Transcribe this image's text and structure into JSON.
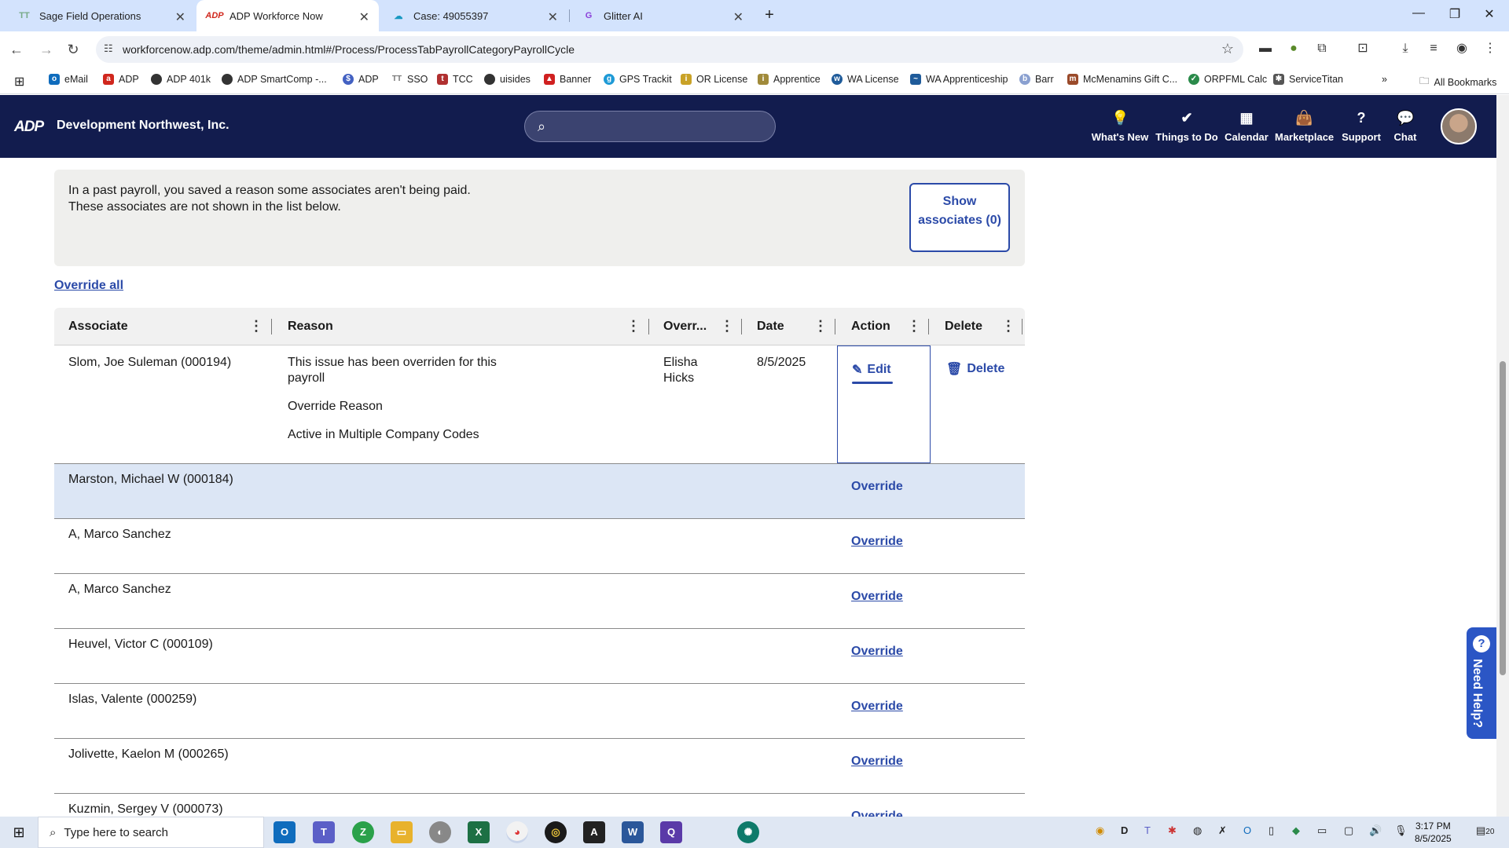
{
  "browser": {
    "tabs": [
      {
        "title": "Sage Field Operations",
        "icon": "TT"
      },
      {
        "title": "ADP Workforce Now",
        "icon": "ADP"
      },
      {
        "title": "Case: 49055397",
        "icon": "cloud"
      },
      {
        "title": "Glitter AI",
        "icon": "G"
      }
    ],
    "url": "workforcenow.adp.com/theme/admin.html#/Process/ProcessTabPayrollCategoryPayrollCycle",
    "bookmarks": [
      "eMail",
      "ADP",
      "ADP 401k",
      "ADP SmartComp -...",
      "ADP",
      "SSO",
      "TCC",
      "uisides",
      "Banner",
      "GPS Trackit",
      "OR License",
      "Apprentice",
      "WA License",
      "WA Apprenticeship",
      "Barr",
      "McMenamins Gift C...",
      "ORPFML Calc",
      "ServiceTitan"
    ],
    "all_bookmarks": "All Bookmarks"
  },
  "header": {
    "logo": "ADP",
    "company": "Development Northwest, Inc.",
    "nav": [
      {
        "label": "What's New",
        "icon": "lightbulb-icon"
      },
      {
        "label": "Things to Do",
        "icon": "checkmark-icon"
      },
      {
        "label": "Calendar",
        "icon": "calendar-icon"
      },
      {
        "label": "Marketplace",
        "icon": "bag-icon"
      },
      {
        "label": "Support",
        "icon": "question-icon"
      },
      {
        "label": "Chat",
        "icon": "chat-icon"
      }
    ]
  },
  "banner": {
    "text": "In a past payroll, you saved a reason some associates aren't being paid. These associates are not shown in the list below.",
    "button": "Show associates (0)"
  },
  "override_all": "Override all",
  "table": {
    "headers": [
      "Associate",
      "Reason",
      "Overr...",
      "Date",
      "Action",
      "Delete"
    ],
    "first_row": {
      "associate": "Slom, Joe Suleman (000194)",
      "reasons": [
        "This issue has been overriden for this payroll",
        "Override Reason",
        "Active in Multiple Company Codes"
      ],
      "overridden_by": "Elisha Hicks",
      "date": "8/5/2025",
      "edit": "Edit",
      "delete": "Delete"
    },
    "rows": [
      {
        "associate": "Marston, Michael W (000184)",
        "action": "Override"
      },
      {
        "associate": "A, Marco Sanchez",
        "action": "Override"
      },
      {
        "associate": "A, Marco Sanchez",
        "action": "Override"
      },
      {
        "associate": "Heuvel, Victor C (000109)",
        "action": "Override"
      },
      {
        "associate": "Islas, Valente (000259)",
        "action": "Override"
      },
      {
        "associate": "Jolivette, Kaelon M (000265)",
        "action": "Override"
      },
      {
        "associate": "Kuzmin, Sergey V (000073)",
        "action": "Override"
      }
    ]
  },
  "need_help": "Need Help?",
  "taskbar": {
    "search_placeholder": "Type here to search",
    "time": "3:17 PM",
    "date": "8/5/2025",
    "notification_count": "20"
  },
  "colors": {
    "header_bg": "#121c4e",
    "link": "#2b4aa8",
    "highlight_row": "#dce6f5"
  }
}
